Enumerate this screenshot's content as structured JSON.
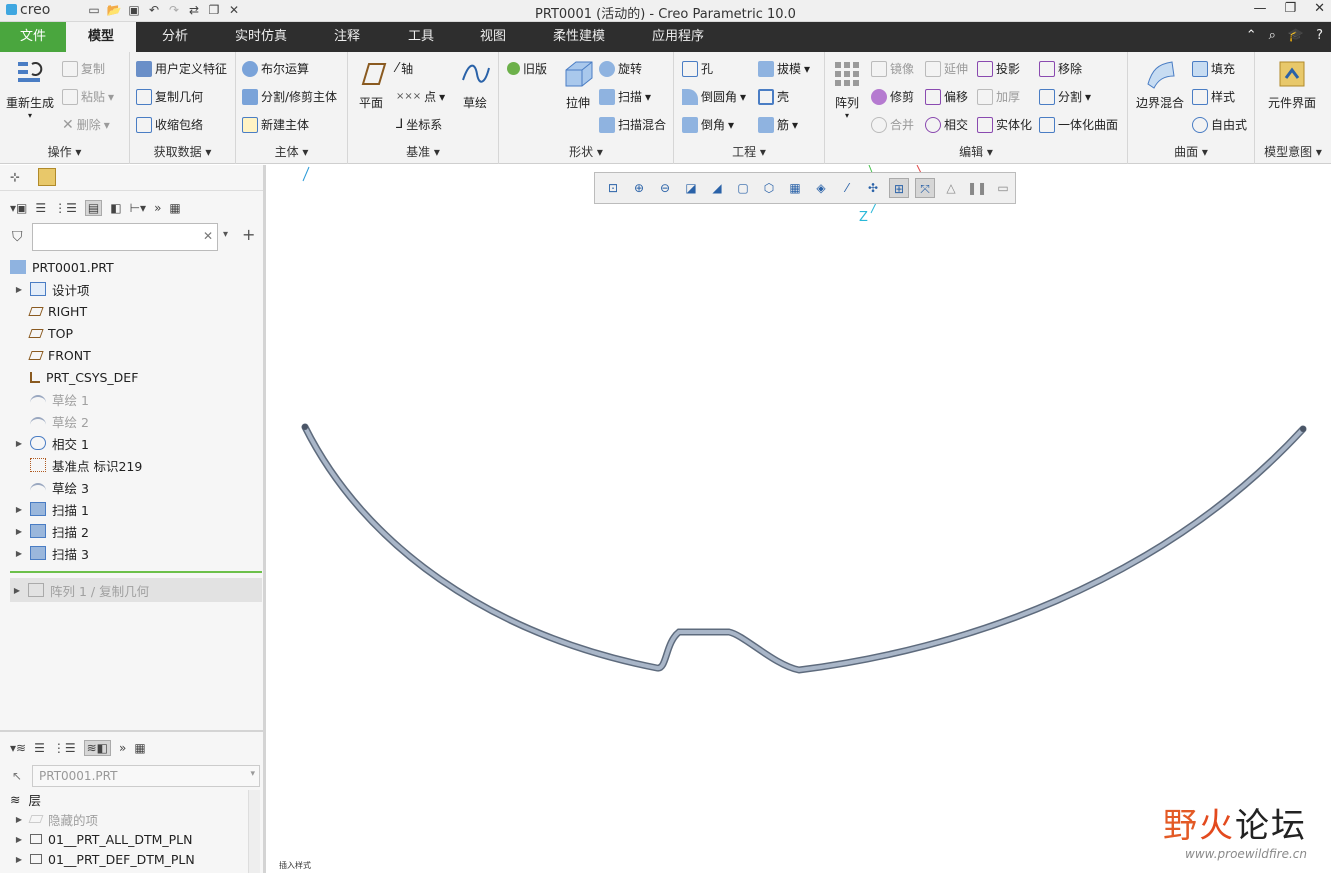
{
  "app": {
    "logo": "creo",
    "window_title": "PRT0001 (活动的) - Creo Parametric 10.0"
  },
  "quick_access": [
    "new-icon",
    "open-icon",
    "save-icon",
    "undo-icon",
    "redo-icon",
    "regenerate-icon",
    "windows-icon",
    "close-icon"
  ],
  "menu": {
    "tabs": [
      "文件",
      "模型",
      "分析",
      "实时仿真",
      "注释",
      "工具",
      "视图",
      "柔性建模",
      "应用程序"
    ],
    "active": "模型"
  },
  "ribbon": {
    "ops": {
      "label": "操作",
      "regen": "重新生成",
      "copy": "复制",
      "paste": "粘贴",
      "delete": "删除"
    },
    "get_data": {
      "label": "获取数据",
      "udf": "用户定义特征",
      "copy_geom": "复制几何",
      "shrinkwrap": "收缩包络"
    },
    "body": {
      "label": "主体",
      "boolean": "布尔运算",
      "split": "分割/修剪主体",
      "new_body": "新建主体"
    },
    "datum": {
      "label": "基准",
      "plane": "平面",
      "axis": "轴",
      "point": "点",
      "csys": "坐标系",
      "sketch": "草绘"
    },
    "shapes": {
      "label": "形状",
      "legacy": "旧版",
      "extrude": "拉伸",
      "revolve": "旋转",
      "sweep": "扫描",
      "swept_blend": "扫描混合"
    },
    "engineering": {
      "label": "工程",
      "hole": "孔",
      "round": "倒圆角",
      "chamfer": "倒角",
      "draft": "拔模",
      "shell": "壳",
      "rib": "筋"
    },
    "editing": {
      "label": "编辑",
      "pattern": "阵列",
      "mirror": "镜像",
      "extend": "延伸",
      "project": "投影",
      "remove": "移除",
      "trim": "修剪",
      "offset": "偏移",
      "thicken": "加厚",
      "split": "分割",
      "merge": "合并",
      "intersect": "相交",
      "solidify": "实体化",
      "unify": "一体化曲面"
    },
    "surfaces": {
      "label": "曲面",
      "boundary": "边界混合",
      "fill": "填充",
      "style": "样式",
      "freestyle": "自由式"
    },
    "model_intent": {
      "label": "模型意图",
      "component_interface": "元件界面"
    }
  },
  "model_tree": {
    "root": "PRT0001.PRT",
    "items": [
      {
        "label": "设计项",
        "icon": "design-items-icon",
        "expandable": true,
        "gray": false
      },
      {
        "label": "RIGHT",
        "icon": "datum-plane-icon",
        "expandable": false,
        "gray": false
      },
      {
        "label": "TOP",
        "icon": "datum-plane-icon",
        "expandable": false,
        "gray": false
      },
      {
        "label": "FRONT",
        "icon": "datum-plane-icon",
        "expandable": false,
        "gray": false
      },
      {
        "label": "PRT_CSYS_DEF",
        "icon": "csys-icon",
        "expandable": false,
        "gray": false
      },
      {
        "label": "草绘 1",
        "icon": "sketch-icon",
        "expandable": false,
        "gray": true
      },
      {
        "label": "草绘 2",
        "icon": "sketch-icon",
        "expandable": false,
        "gray": true
      },
      {
        "label": "相交 1",
        "icon": "intersect-icon",
        "expandable": true,
        "gray": false
      },
      {
        "label": "基准点 标识219",
        "icon": "datum-point-icon",
        "expandable": false,
        "gray": false
      },
      {
        "label": "草绘 3",
        "icon": "sketch-icon",
        "expandable": false,
        "gray": false
      },
      {
        "label": "扫描 1",
        "icon": "sweep-icon",
        "expandable": true,
        "gray": false
      },
      {
        "label": "扫描 2",
        "icon": "sweep-icon",
        "expandable": true,
        "gray": false
      },
      {
        "label": "扫描 3",
        "icon": "sweep-icon",
        "expandable": true,
        "gray": false
      }
    ],
    "insert_item": "阵列 1 / 复制几何"
  },
  "layer_tree": {
    "model_select": "PRT0001.PRT",
    "header": "层",
    "items": [
      {
        "label": "隐藏的项",
        "gray": true
      },
      {
        "label": "01__PRT_ALL_DTM_PLN",
        "gray": false
      },
      {
        "label": "01__PRT_DEF_DTM_PLN",
        "gray": false
      }
    ]
  },
  "viewport": {
    "csys_label": "Z",
    "status_note": "插入样式"
  },
  "watermark": {
    "text1": "野",
    "text2": "火",
    "text3": "论坛",
    "url": "www.proewildfire.cn"
  },
  "colors": {
    "file_tab": "#4aa63e",
    "menubar": "#2e2e2e",
    "accent": "#2a62a8",
    "tube": "#8d9bb0"
  }
}
